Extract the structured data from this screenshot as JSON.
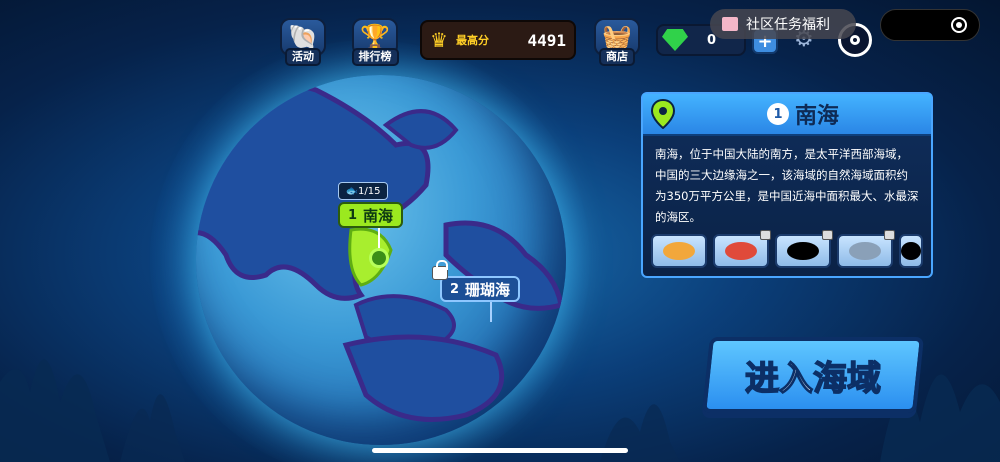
{
  "topbar": {
    "activity_label": "活动",
    "ranking_label": "排行榜",
    "score_label": "最高分",
    "score_value": "4491",
    "shop_label": "商店",
    "gem_value": "0",
    "plus_label": "+",
    "community_label": "社区任务福利"
  },
  "map": {
    "region1": {
      "number": "1",
      "name": "南海",
      "progress_tag": "1/15"
    },
    "region2": {
      "number": "2",
      "name": "珊瑚海"
    }
  },
  "panel": {
    "number": "1",
    "title": "南海",
    "description": "南海，位于中国大陆的南方，是太平洋西部海域，中国的三大边缘海之一，该海域的自然海域面积约为350万平方公里，是中国近海中面积最大、水最深的海区。",
    "fish": [
      {
        "name": "puffer-fish",
        "locked": false,
        "color": "#f2a73b"
      },
      {
        "name": "red-fish",
        "locked": true,
        "color": "#e04a3a"
      },
      {
        "name": "silhouette-fish",
        "locked": true,
        "color": "#000000"
      },
      {
        "name": "grey-fish",
        "locked": true,
        "color": "#8aa0b8"
      },
      {
        "name": "silhouette-fish-partial",
        "locked": false,
        "color": "#000000"
      }
    ]
  },
  "enter_button": {
    "label": "进入海域"
  },
  "colors": {
    "accent": "#2b8ff0",
    "highlight": "#9be91f",
    "gold": "#ffcf26"
  }
}
